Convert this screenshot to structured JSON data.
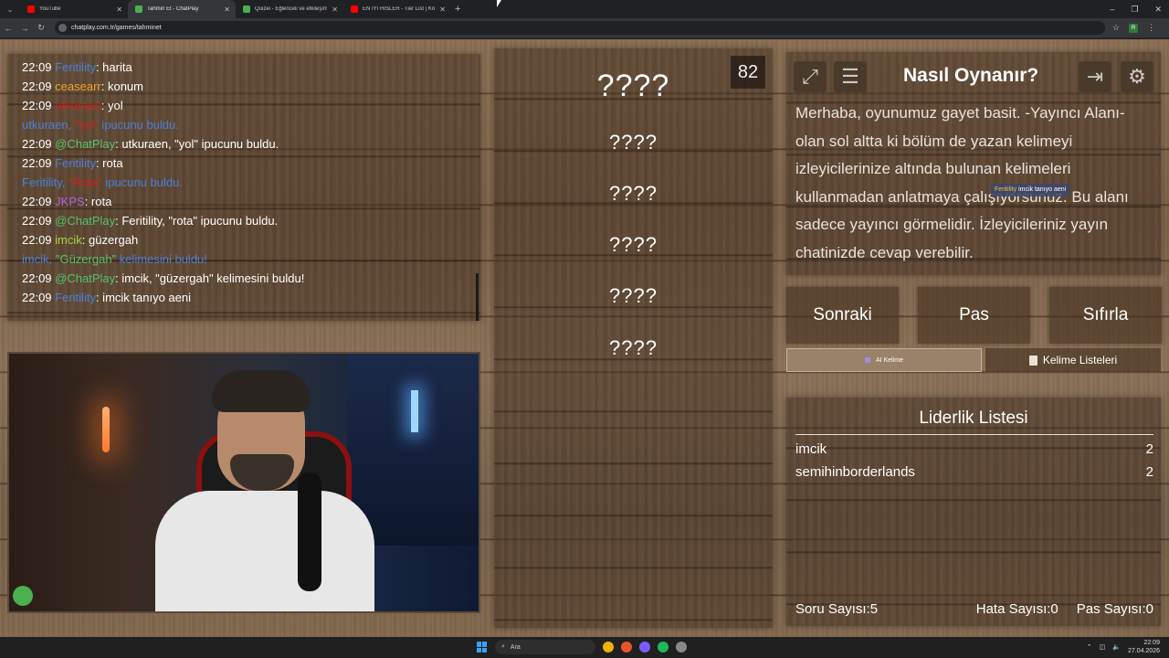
{
  "browser": {
    "tabs": [
      {
        "title": "YouTube",
        "color": "#ff0000"
      },
      {
        "title": "Tahmin Et - ChatPlay",
        "color": "#4caf50"
      },
      {
        "title": "Quizei - Eğlenceli ve etkileşimli",
        "color": "#4caf50"
      },
      {
        "title": "EN IYI HISLER - Tier List | Kör Sı",
        "color": "#ff0000"
      }
    ],
    "url": "chatplay.com.tr/games/tahminet"
  },
  "chat": [
    {
      "time": "22:09",
      "user": "Feritility",
      "user_color": "#4a7fd6",
      "text": ": harita"
    },
    {
      "time": "22:09",
      "user": "ceasearr",
      "user_color": "#f0a030",
      "text": ": konum"
    },
    {
      "time": "22:09",
      "user": "utkuraen",
      "user_color": "#d02020",
      "text": ": yol"
    },
    {
      "system": true,
      "a": "utkuraen, ",
      "hl": "\"yol\"",
      "hl_color": "#d02020",
      "b": " ipucunu buldu."
    },
    {
      "time": "22:09",
      "user": "@ChatPlay",
      "user_color": "#54c06a",
      "text": ": utkuraen, \"yol\" ipucunu buldu."
    },
    {
      "time": "22:09",
      "user": "Feritility",
      "user_color": "#4a7fd6",
      "text": ": rota"
    },
    {
      "system": true,
      "a": "Feritility, ",
      "hl": "\"Rota\"",
      "hl_color": "#d02020",
      "b": " ipucunu buldu."
    },
    {
      "time": "22:09",
      "user": "JKPS",
      "user_color": "#b060e0",
      "text": ": rota"
    },
    {
      "time": "22:09",
      "user": "@ChatPlay",
      "user_color": "#54c06a",
      "text": ": Feritility, \"rota\" ipucunu buldu."
    },
    {
      "time": "22:09",
      "user": "imcik",
      "user_color": "#a8d040",
      "text": ": güzergah"
    },
    {
      "system": true,
      "a": "imcik, ",
      "hl": "\"Güzergah\"",
      "hl_color": "#54c06a",
      "b": " kelimesini buldu!"
    },
    {
      "time": "22:09",
      "user": "@ChatPlay",
      "user_color": "#54c06a",
      "text": ": imcik, \"güzergah\" kelimesini buldu!"
    },
    {
      "time": "22:09",
      "user": "Feritility",
      "user_color": "#4a7fd6",
      "text": ": imcik tanıyo aeni"
    }
  ],
  "game": {
    "timer": "82",
    "words": [
      "????",
      "????",
      "????",
      "????",
      "????",
      "????"
    ]
  },
  "info": {
    "title": "Nasıl Oynanır?",
    "text": "Merhaba, oyunumuz gayet basit. -Yayıncı Alanı- olan sol altta ki bölüm de yazan kelimeyi izleyicilerinize altında bulunan kelimeleri kullanmadan anlatmaya çalışıyorsunuz. Bu alanı sadece yayıncı görmelidir. İzleyicileriniz yayın chatinizde cevap verebilir.",
    "overlay_user": "Feritility",
    "overlay_text": "imcik tanıyo aeni",
    "icons": [
      "fullscreen-icon",
      "list-icon",
      "logout-icon",
      "gear-icon"
    ]
  },
  "buttons": {
    "next": "Sonraki",
    "pass": "Pas",
    "reset": "Sıfırla",
    "ai_word": "AI Kelime",
    "word_lists": "Kelime Listeleri"
  },
  "leaderboard": {
    "title": "Liderlik Listesi",
    "rows": [
      {
        "name": "imcik",
        "score": "2"
      },
      {
        "name": "semihinborderlands",
        "score": "2"
      }
    ],
    "question_count": "Soru Sayısı:5",
    "error_count": "Hata Sayısı:0",
    "pass_count": "Pas Sayısı:0"
  },
  "taskbar": {
    "search": "Ara",
    "time": "22:09",
    "date": "27.04.2026"
  }
}
